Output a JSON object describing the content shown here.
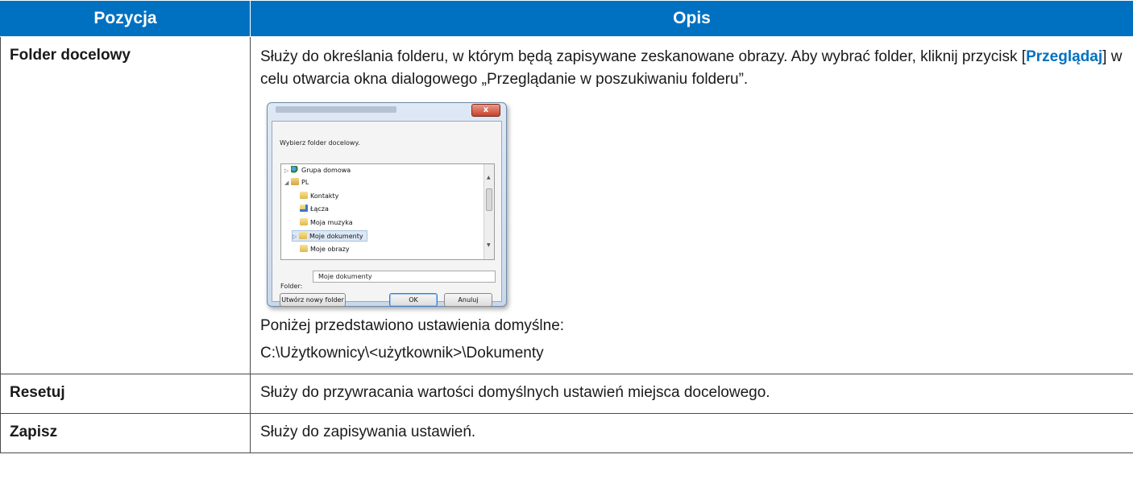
{
  "header": {
    "col1": "Pozycja",
    "col2": "Opis"
  },
  "rows": [
    {
      "item": "Folder docelowy",
      "desc_a": "Służy do określania folderu, w którym będą zapisywane zeskanowane obrazy. Aby wybrać folder, kliknij przycisk [",
      "desc_kw": "Przeglądaj",
      "desc_b": "] w celu otwarcia okna dialogowego „Przeglądanie w poszukiwaniu folderu”.",
      "default_intro": "Poniżej przedstawiono ustawienia domyślne:",
      "default_path": "C:\\Użytkownicy\\<użytkownik>\\Dokumenty"
    },
    {
      "item": "Resetuj",
      "desc": "Służy do przywracania wartości domyślnych ustawień miejsca docelowego."
    },
    {
      "item": "Zapisz",
      "desc": "Służy do zapisywania ustawień."
    }
  ],
  "dialog": {
    "close_glyph": "x",
    "prompt": "Wybierz folder docelowy.",
    "tree": [
      {
        "label": "Grupa domowa",
        "icon": "network-icon",
        "expander": "▷"
      },
      {
        "label": "PL",
        "icon": "user-folder-icon",
        "expander": "◢"
      },
      {
        "label": "Kontakty",
        "icon": "folder-icon"
      },
      {
        "label": "Łącza",
        "icon": "links-folder-icon"
      },
      {
        "label": "Moja muzyka",
        "icon": "folder-icon"
      },
      {
        "label": "Moje dokumenty",
        "icon": "folder-icon",
        "expander": "▷",
        "selected": true
      },
      {
        "label": "Moje obrazy",
        "icon": "folder-icon"
      }
    ],
    "folder_label": "Folder:",
    "folder_value": "Moje dokumenty",
    "new_folder_button": "Utwórz nowy folder",
    "ok_button": "OK",
    "cancel_button": "Anuluj"
  },
  "colors": {
    "header_bg": "#0071c1",
    "keyword": "#0071c1"
  }
}
